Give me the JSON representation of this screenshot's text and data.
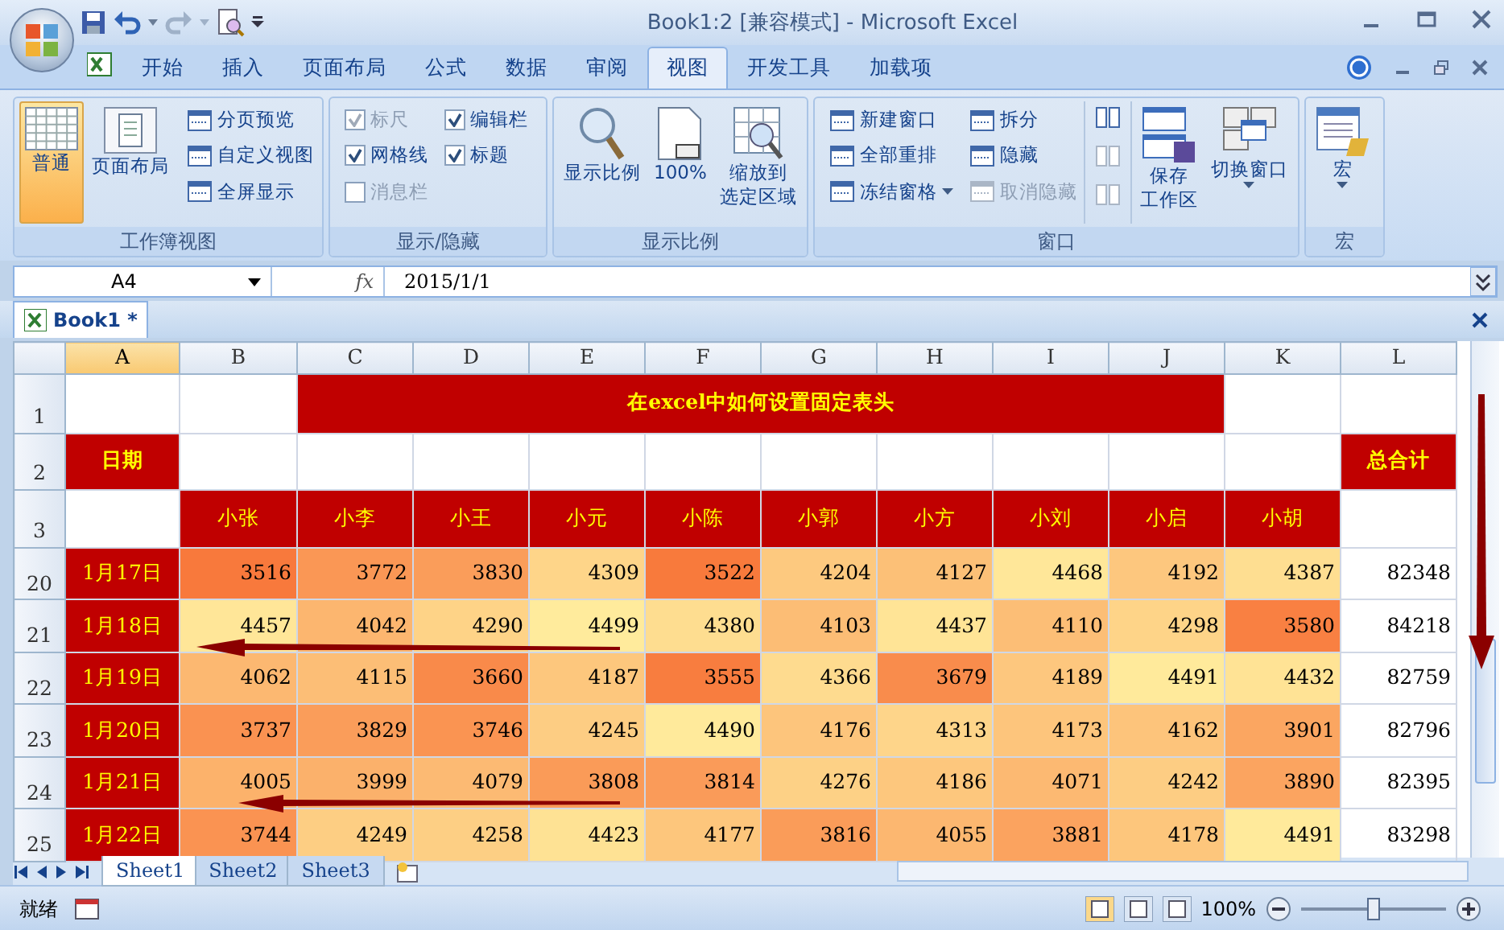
{
  "window": {
    "title": "Book1:2  [兼容模式] - Microsoft Excel"
  },
  "ribbon_tabs": [
    {
      "label": "开始",
      "selected": false
    },
    {
      "label": "插入",
      "selected": false
    },
    {
      "label": "页面布局",
      "selected": false
    },
    {
      "label": "公式",
      "selected": false
    },
    {
      "label": "数据",
      "selected": false
    },
    {
      "label": "审阅",
      "selected": false
    },
    {
      "label": "视图",
      "selected": true
    },
    {
      "label": "开发工具",
      "selected": false
    },
    {
      "label": "加载项",
      "selected": false
    }
  ],
  "ribbon_groups": [
    {
      "title": "工作簿视图",
      "items": [
        {
          "kind": "large",
          "label": "普通",
          "selected": true
        },
        {
          "kind": "large",
          "label": "页面布局",
          "selected": false
        },
        {
          "kind": "small",
          "label": "分页预览",
          "disabled": false
        },
        {
          "kind": "small",
          "label": "自定义视图",
          "disabled": false
        },
        {
          "kind": "small",
          "label": "全屏显示",
          "disabled": false
        }
      ]
    },
    {
      "title": "显示/隐藏",
      "items": [
        {
          "kind": "checkbox",
          "label": "标尺",
          "checked": true,
          "disabled": true
        },
        {
          "kind": "checkbox",
          "label": "网格线",
          "checked": true,
          "disabled": false
        },
        {
          "kind": "checkbox",
          "label": "消息栏",
          "checked": false,
          "disabled": true
        },
        {
          "kind": "checkbox",
          "label": "编辑栏",
          "checked": true,
          "disabled": false
        },
        {
          "kind": "checkbox",
          "label": "标题",
          "checked": true,
          "disabled": false
        }
      ]
    },
    {
      "title": "显示比例",
      "items": [
        {
          "kind": "large",
          "label": "显示比例",
          "selected": false
        },
        {
          "kind": "large",
          "label": "100%",
          "selected": false
        },
        {
          "kind": "large",
          "label_lines": [
            "缩放到",
            "选定区域"
          ],
          "selected": false
        }
      ]
    },
    {
      "title": "窗口",
      "items": [
        {
          "kind": "small",
          "label": "新建窗口",
          "disabled": false
        },
        {
          "kind": "small",
          "label": "全部重排",
          "disabled": false
        },
        {
          "kind": "small",
          "label": "冻结窗格",
          "disabled": false,
          "dropdown": true
        },
        {
          "kind": "small",
          "label": "拆分",
          "disabled": false
        },
        {
          "kind": "small",
          "label": "隐藏",
          "disabled": false
        },
        {
          "kind": "small",
          "label": "取消隐藏",
          "disabled": true
        },
        {
          "kind": "tiny",
          "disabled": false
        },
        {
          "kind": "tiny",
          "disabled": true
        },
        {
          "kind": "tiny",
          "disabled": true
        },
        {
          "kind": "large",
          "label_lines": [
            "保存",
            "工作区"
          ],
          "selected": false
        },
        {
          "kind": "large",
          "label": "切换窗口",
          "selected": false,
          "dropdown": true
        }
      ]
    },
    {
      "title": "宏",
      "items": [
        {
          "kind": "large",
          "label": "宏",
          "selected": false,
          "dropdown": true
        }
      ]
    }
  ],
  "formula_bar": {
    "name_box": "A4",
    "function_label": "fx",
    "value": "2015/1/1"
  },
  "workbook_tab": {
    "title": "Book1 *"
  },
  "sheet": {
    "columns": [
      {
        "label": "A",
        "selected": true
      },
      {
        "label": "B",
        "selected": false
      },
      {
        "label": "C",
        "selected": false
      },
      {
        "label": "D",
        "selected": false
      },
      {
        "label": "E",
        "selected": false
      },
      {
        "label": "F",
        "selected": false
      },
      {
        "label": "G",
        "selected": false
      },
      {
        "label": "H",
        "selected": false
      },
      {
        "label": "I",
        "selected": false
      },
      {
        "label": "J",
        "selected": false
      },
      {
        "label": "K",
        "selected": false
      },
      {
        "label": "L",
        "selected": false
      }
    ],
    "rows": [
      {
        "header": "1",
        "cells": [
          {
            "kind": "blank"
          },
          {
            "kind": "blank"
          },
          {
            "kind": "banner",
            "text": "在excel中如何设置固定表头"
          },
          {
            "kind": "blank"
          },
          {
            "kind": "blank"
          }
        ]
      },
      {
        "header": "2",
        "cells": [
          {
            "kind": "label",
            "text": "日期"
          },
          {
            "kind": "blank"
          },
          {
            "kind": "blank"
          },
          {
            "kind": "blank"
          },
          {
            "kind": "blank"
          },
          {
            "kind": "blank"
          },
          {
            "kind": "blank"
          },
          {
            "kind": "blank"
          },
          {
            "kind": "blank"
          },
          {
            "kind": "blank"
          },
          {
            "kind": "blank"
          },
          {
            "kind": "label",
            "text": "总合计"
          }
        ]
      },
      {
        "header": "3",
        "cells": [
          {
            "kind": "blank"
          },
          {
            "kind": "name",
            "text": "小张"
          },
          {
            "kind": "name",
            "text": "小李"
          },
          {
            "kind": "name",
            "text": "小王"
          },
          {
            "kind": "name",
            "text": "小元"
          },
          {
            "kind": "name",
            "text": "小陈"
          },
          {
            "kind": "name",
            "text": "小郭"
          },
          {
            "kind": "name",
            "text": "小方"
          },
          {
            "kind": "name",
            "text": "小刘"
          },
          {
            "kind": "name",
            "text": "小启"
          },
          {
            "kind": "name",
            "text": "小胡"
          },
          {
            "kind": "blank"
          }
        ]
      },
      {
        "header": "20",
        "date": "1月17日",
        "values": [
          "3516",
          "3772",
          "3830",
          "4309",
          "3522",
          "4204",
          "4127",
          "4468",
          "4192",
          "4387"
        ],
        "total": "82348"
      },
      {
        "header": "21",
        "date": "1月18日",
        "values": [
          "4457",
          "4042",
          "4290",
          "4499",
          "4380",
          "4103",
          "4437",
          "4110",
          "4298",
          "3580"
        ],
        "total": "84218"
      },
      {
        "header": "22",
        "date": "1月19日",
        "values": [
          "4062",
          "4115",
          "3660",
          "4187",
          "3555",
          "4366",
          "3679",
          "4189",
          "4491",
          "4432"
        ],
        "total": "82759"
      },
      {
        "header": "23",
        "date": "1月20日",
        "values": [
          "3737",
          "3829",
          "3746",
          "4245",
          "4490",
          "4176",
          "4313",
          "4173",
          "4162",
          "3901"
        ],
        "total": "82796"
      },
      {
        "header": "24",
        "date": "1月21日",
        "values": [
          "4005",
          "3999",
          "4079",
          "3808",
          "3814",
          "4276",
          "4186",
          "4071",
          "4242",
          "3890"
        ],
        "total": "82395"
      },
      {
        "header": "25",
        "date": "1月22日",
        "values": [
          "3744",
          "4249",
          "4258",
          "4423",
          "4177",
          "3816",
          "4055",
          "3881",
          "4178",
          "4491"
        ],
        "total": "83298"
      }
    ]
  },
  "sheet_tabs": [
    {
      "label": "Sheet1",
      "selected": true
    },
    {
      "label": "Sheet2",
      "selected": false
    },
    {
      "label": "Sheet3",
      "selected": false
    }
  ],
  "status_bar": {
    "status": "就绪",
    "zoom": "100%",
    "zoom_level": {
      "level": 0.5
    }
  }
}
